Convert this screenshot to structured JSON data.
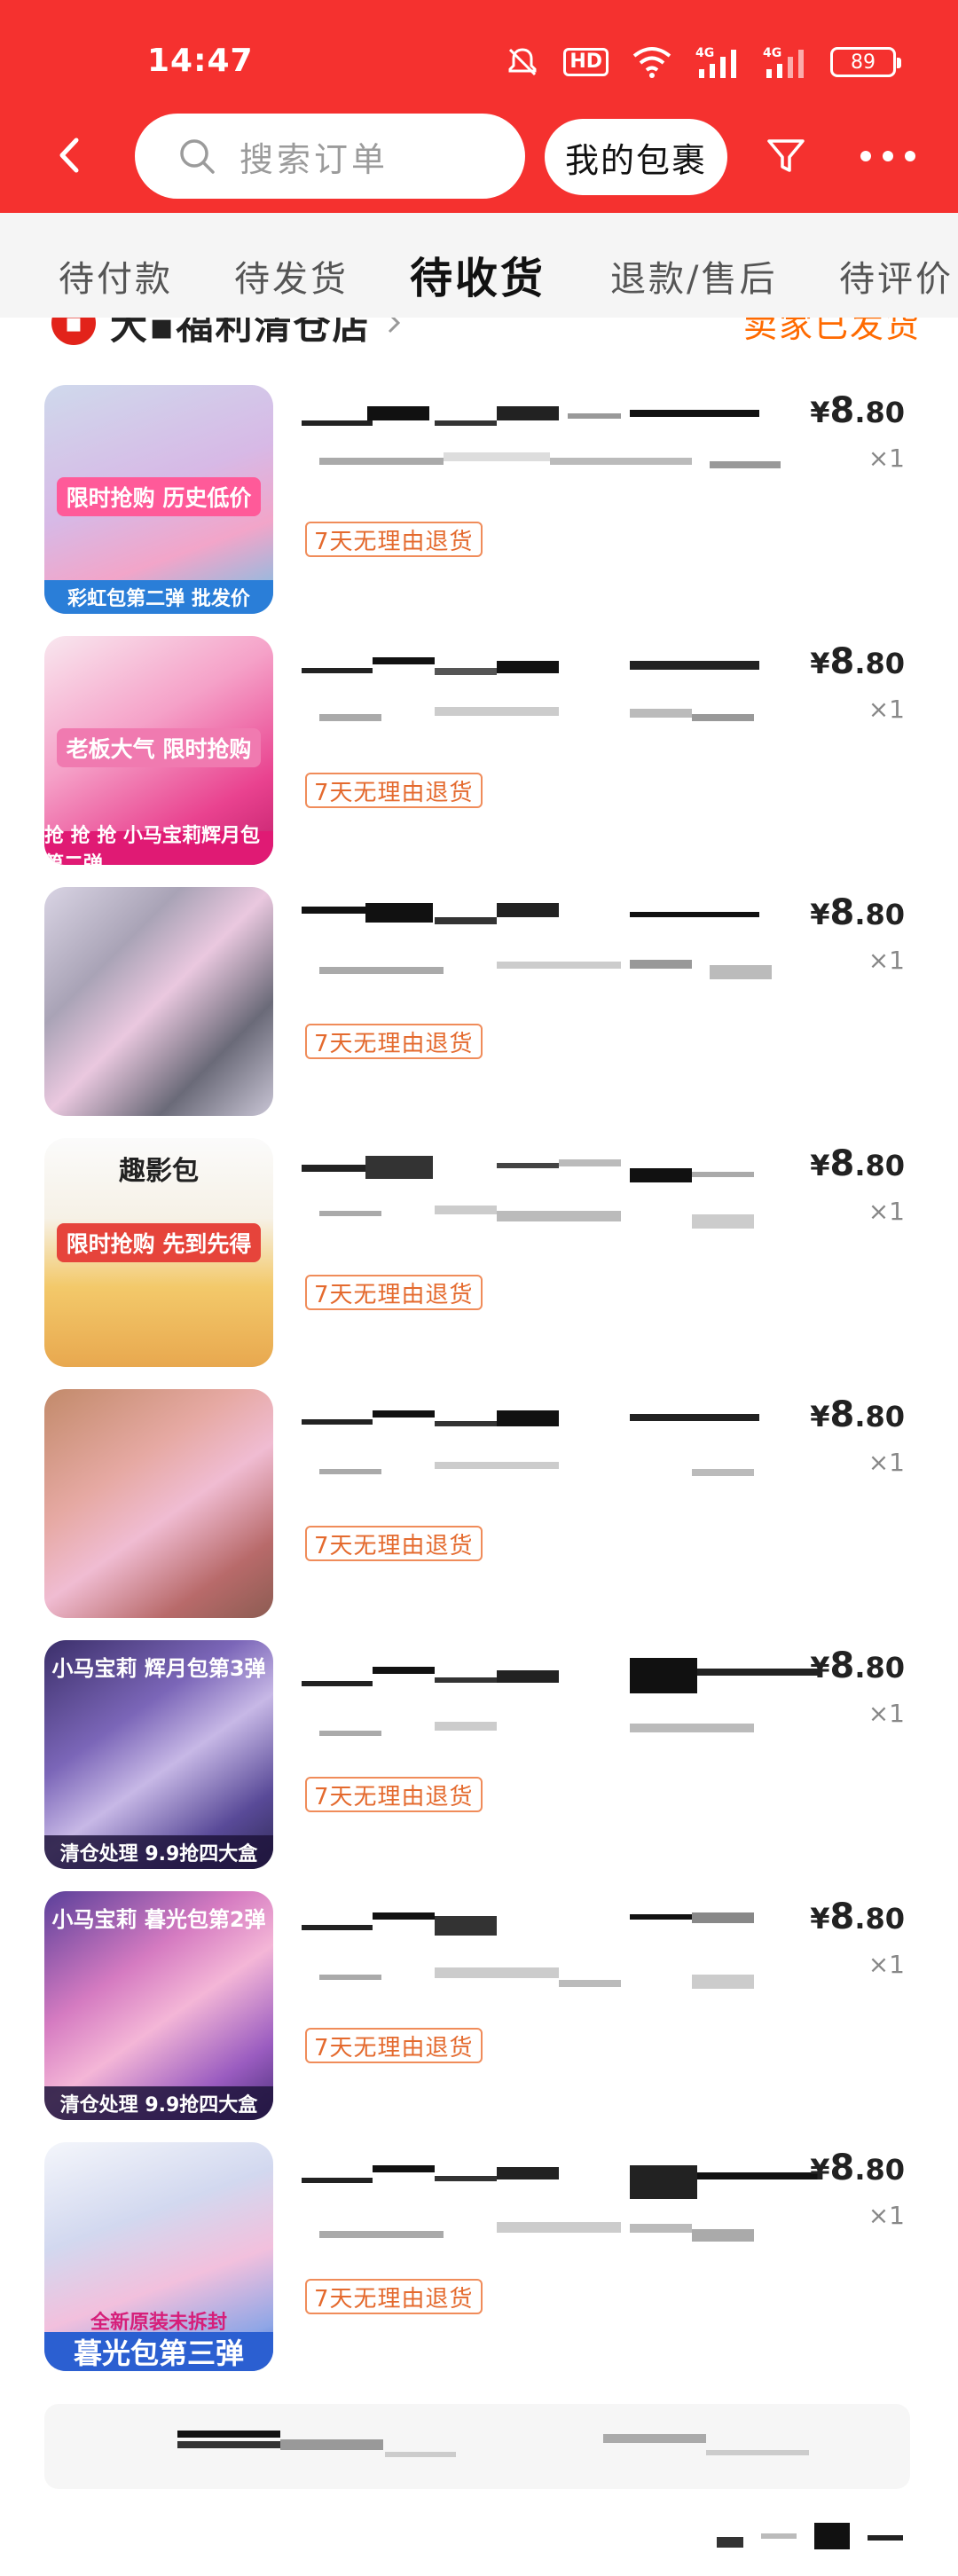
{
  "status_bar": {
    "time": "14:47",
    "battery": "89",
    "hd_label": "HD",
    "network": "4G"
  },
  "header": {
    "search_placeholder": "搜索订单",
    "my_package_label": "我的包裹"
  },
  "tabs": [
    {
      "label": "待付款",
      "active": false
    },
    {
      "label": "待发货",
      "active": false
    },
    {
      "label": "待收货",
      "active": true
    },
    {
      "label": "退款/售后",
      "active": false
    },
    {
      "label": "待评价",
      "active": false
    }
  ],
  "shop": {
    "name": "大▪福利清仓店",
    "status": "卖家已发货"
  },
  "items": [
    {
      "price_currency": "¥",
      "price_int": "8",
      "price_dec": ".80",
      "qty": "×1",
      "tag": "7天无理由退货",
      "thumb_caption": "彩虹包第二弹 批发价",
      "thumb_promo": "限时抢购 历史低价"
    },
    {
      "price_currency": "¥",
      "price_int": "8",
      "price_dec": ".80",
      "qty": "×1",
      "tag": "7天无理由退货",
      "thumb_caption": "抢 抢 抢 小马宝莉辉月包第二弹",
      "thumb_promo": "老板大气 限时抢购"
    },
    {
      "price_currency": "¥",
      "price_int": "8",
      "price_dec": ".80",
      "qty": "×1",
      "tag": "7天无理由退货",
      "thumb_caption": "",
      "thumb_promo": ""
    },
    {
      "price_currency": "¥",
      "price_int": "8",
      "price_dec": ".80",
      "qty": "×1",
      "tag": "7天无理由退货",
      "thumb_caption": "",
      "thumb_promo": "限时抢购 先到先得",
      "thumb_top": "趣影包"
    },
    {
      "price_currency": "¥",
      "price_int": "8",
      "price_dec": ".80",
      "qty": "×1",
      "tag": "7天无理由退货",
      "thumb_caption": "",
      "thumb_promo": ""
    },
    {
      "price_currency": "¥",
      "price_int": "8",
      "price_dec": ".80",
      "qty": "×1",
      "tag": "7天无理由退货",
      "thumb_caption": "清仓处理 9.9抢四大盒",
      "thumb_promo": "",
      "thumb_top": "小马宝莉 辉月包第3弹"
    },
    {
      "price_currency": "¥",
      "price_int": "8",
      "price_dec": ".80",
      "qty": "×1",
      "tag": "7天无理由退货",
      "thumb_caption": "清仓处理 9.9抢四大盒",
      "thumb_promo": "",
      "thumb_top": "小马宝莉 暮光包第2弹"
    },
    {
      "price_currency": "¥",
      "price_int": "8",
      "price_dec": ".80",
      "qty": "×1",
      "tag": "7天无理由退货",
      "thumb_caption": "暮光包第三弹",
      "thumb_promo": "全新原装未拆封"
    }
  ],
  "colors": {
    "brand_red": "#f5312f",
    "tag_orange": "#e46a2e",
    "shop_status": "#ff6a00"
  }
}
